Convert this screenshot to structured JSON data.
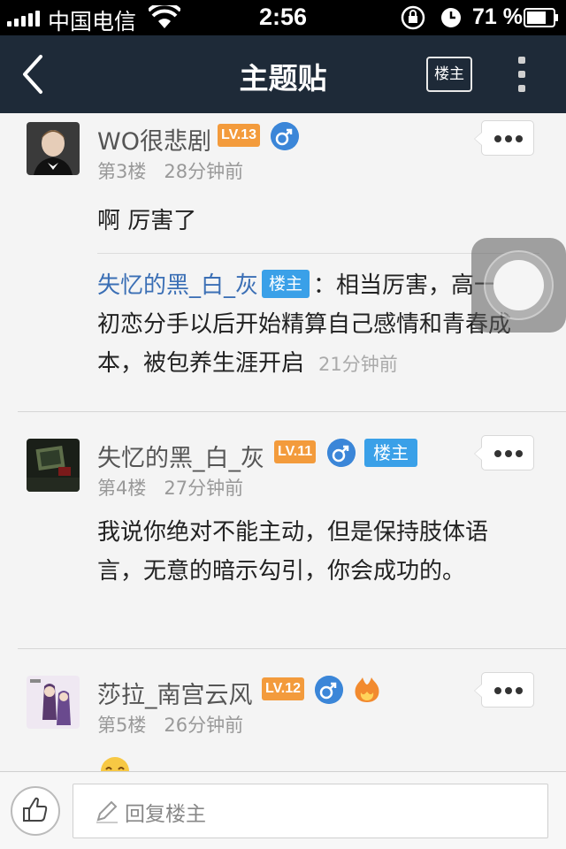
{
  "status_bar": {
    "carrier": "中国电信",
    "time": "2:56",
    "battery_percent": "71 %",
    "icons": [
      "signal-icon",
      "wifi-icon",
      "rotation-lock-icon",
      "alarm-icon",
      "battery-icon"
    ]
  },
  "nav": {
    "title": "主题贴",
    "louzhu_button": "楼主",
    "icons": [
      "back-arrow-icon",
      "more-vertical-icon"
    ]
  },
  "posts": [
    {
      "author": "WO很悲剧",
      "level": "LV.13",
      "floor": "第3楼",
      "time": "28分钟前",
      "content": "啊 厉害了",
      "reply": {
        "name": "失忆的黑_白_灰",
        "badge": "楼主",
        "text": "：相当厉害，高一和初恋分手以后开始精算自己感情和青春成本，被包养生涯开启",
        "time": "21分钟前"
      }
    },
    {
      "author": "失忆的黑_白_灰",
      "level": "LV.11",
      "badge": "楼主",
      "floor": "第4楼",
      "time": "27分钟前",
      "content": "我说你绝对不能主动，但是保持肢体语言，无意的暗示勾引，你会成功的。"
    },
    {
      "author": "莎拉_南宫云风",
      "level": "LV.12",
      "floor": "第5楼",
      "time": "26分钟前",
      "content": ""
    }
  ],
  "bottom_bar": {
    "reply_placeholder": "回复楼主",
    "icons": [
      "thumbs-up-icon",
      "pencil-icon"
    ]
  },
  "colors": {
    "nav_bg": "#1e2a38",
    "level_badge": "#f39b3c",
    "louzhu_badge": "#3aa0e8",
    "link_blue": "#3b6fb5",
    "gender_blue": "#3b86d8"
  }
}
